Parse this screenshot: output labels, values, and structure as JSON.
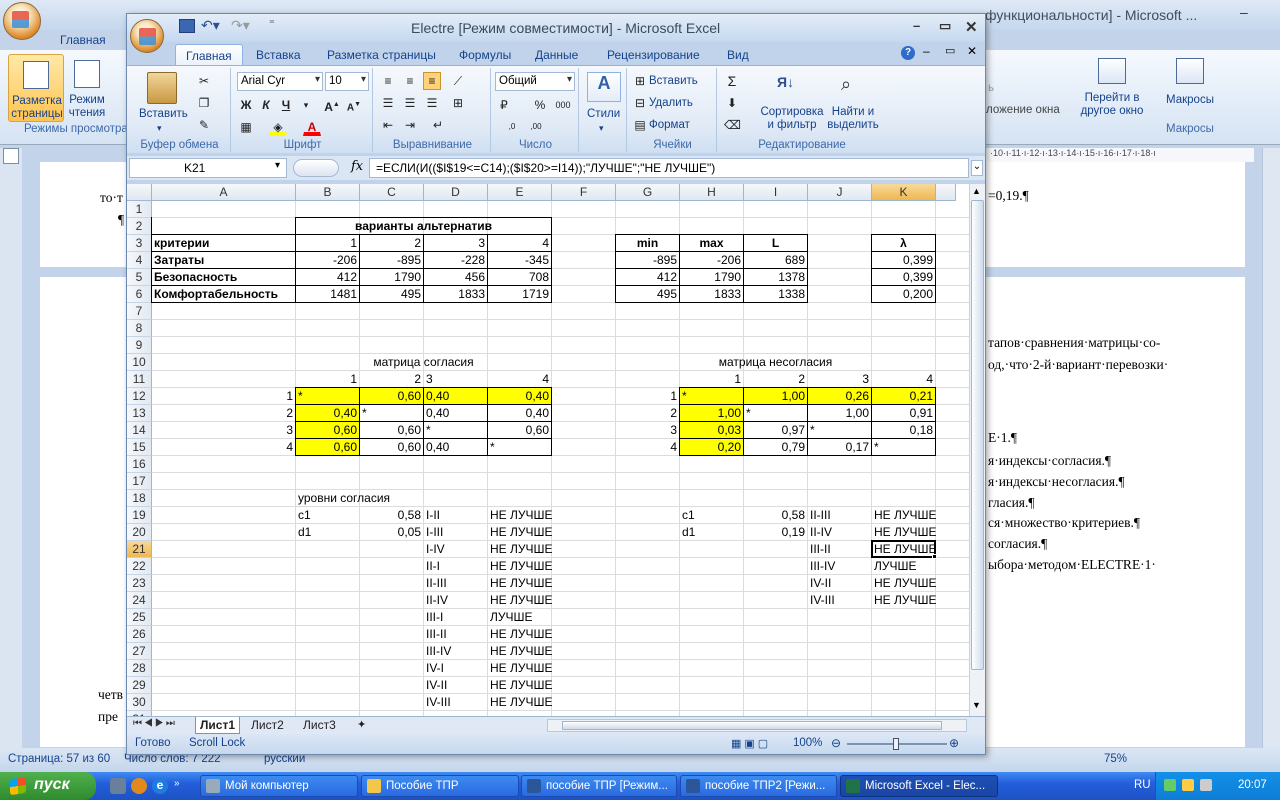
{
  "word": {
    "title_tail": "функциональности] - Microsoft ...",
    "tab_home": "Главная",
    "views": {
      "print_layout": "Разметка страницы",
      "reading": "Режим чтения",
      "group": "Режимы просмотра"
    },
    "right": {
      "window_fragment": "ложение окна",
      "goto_other": "Перейти в другое окно",
      "macros": "Макросы",
      "macros_group": "Макросы"
    },
    "doc_left": {
      "line1": "то·т",
      "line2": "¶",
      "line3": "четв",
      "line4": "пре"
    },
    "doc_right": {
      "l1": "=0,19.¶",
      "l2": "тапов·сравнения·матрицы·со-",
      "l3": "од,·что·2-й·вариант·перевозки·",
      "l4": "Е·1.¶",
      "l5": "я·индексы·согласия.¶",
      "l6": "я·индексы·несогласия.¶",
      "l7": "гласия.¶",
      "l8": "ся·множество·критериев.¶",
      "l9": "согласия.¶",
      "l10": "ыбора·методом·ELECTRE·1·"
    },
    "status": {
      "page": "Страница: 57 из 60",
      "words": "Число слов: 7 222",
      "lang": "русский",
      "zoom": "75%"
    }
  },
  "excel": {
    "title": "Electre  [Режим совместимости] - Microsoft Excel",
    "tabs": [
      "Главная",
      "Вставка",
      "Разметка страницы",
      "Формулы",
      "Данные",
      "Рецензирование",
      "Вид"
    ],
    "ribbon": {
      "paste": "Вставить",
      "clipboard": "Буфер обмена",
      "font_name": "Arial Cyr",
      "font_size": "10",
      "font_group": "Шрифт",
      "bold": "Ж",
      "italic": "К",
      "underline": "Ч",
      "align_group": "Выравнивание",
      "number_format": "Общий",
      "number_group": "Число",
      "styles": "Стили",
      "insert": "Вставить",
      "delete": "Удалить",
      "format": "Формат",
      "cells_group": "Ячейки",
      "sort": "Сортировка и фильтр",
      "find": "Найти и выделить",
      "editing_group": "Редактирование"
    },
    "name_box": "K21",
    "formula": "=ЕСЛИ(И(($I$19<=C14);($I$20>=I14));\"ЛУЧШЕ\";\"НЕ ЛУЧШЕ\")",
    "columns": [
      "A",
      "B",
      "C",
      "D",
      "E",
      "F",
      "G",
      "H",
      "I",
      "J",
      "K"
    ],
    "rows": [
      "1",
      "2",
      "3",
      "4",
      "5",
      "6",
      "7",
      "8",
      "9",
      "10",
      "11",
      "12",
      "13",
      "14",
      "15",
      "16",
      "17",
      "18",
      "19",
      "20",
      "21",
      "22",
      "23",
      "24",
      "25",
      "26",
      "27",
      "28",
      "29",
      "30",
      "31"
    ],
    "cells": {
      "B2": "варианты альтернатив",
      "A3": "критерии",
      "B3": "1",
      "C3": "2",
      "D3": "3",
      "E3": "4",
      "G3": "min",
      "H3": "max",
      "I3": "L",
      "K3": "λ",
      "A4": "Затраты",
      "B4": "-206",
      "C4": "-895",
      "D4": "-228",
      "E4": "-345",
      "G4": "-895",
      "H4": "-206",
      "I4": "689",
      "K4": "0,399",
      "A5": "Безопасность",
      "B5": "412",
      "C5": "1790",
      "D5": "456",
      "E5": "708",
      "G5": "412",
      "H5": "1790",
      "I5": "1378",
      "K5": "0,399",
      "A6": "Комфортабельность",
      "B6": "1481",
      "C6": "495",
      "D6": "1833",
      "E6": "1719",
      "G6": "495",
      "H6": "1833",
      "I6": "1338",
      "K6": "0,200",
      "C10": "матрица согласия",
      "I10": "матрица несогласия",
      "B11": "1",
      "C11": "2",
      "D11": "3",
      "E11": "4",
      "H11": "1",
      "I11": "2",
      "J11": "3",
      "K11": "4",
      "A12": "1",
      "B12": "*",
      "C12": "0,60",
      "D12": "0,40",
      "E12": "0,40",
      "G12": "1",
      "H12": "*",
      "I12": "1,00",
      "J12": "0,26",
      "K12": "0,21",
      "A13": "2",
      "B13": "0,40",
      "C13": "*",
      "D13": "0,40",
      "E13": "0,40",
      "G13": "2",
      "H13": "1,00",
      "I13": "*",
      "J13": "1,00",
      "K13": "0,91",
      "A14": "3",
      "B14": "0,60",
      "C14": "0,60",
      "D14": "*",
      "E14": "0,60",
      "G14": "3",
      "H14": "0,03",
      "I14": "0,97",
      "J14": "*",
      "K14": "0,18",
      "A15": "4",
      "B15": "0,60",
      "C15": "0,60",
      "D15": "0,40",
      "E15": "*",
      "G15": "4",
      "H15": "0,20",
      "I15": "0,79",
      "J15": "0,17",
      "K15": "*",
      "B18": "уровни согласия",
      "B19": "c1",
      "C19": "0,58",
      "D19": "I-II",
      "E19": "НЕ ЛУЧШЕ",
      "H19": "c1",
      "I19": "0,58",
      "J19": "II-III",
      "K19": "НЕ ЛУЧШЕ",
      "B20": "d1",
      "C20": "0,05",
      "D20": "I-III",
      "E20": "НЕ ЛУЧШЕ",
      "H20": "d1",
      "I20": "0,19",
      "J20": "II-IV",
      "K20": "НЕ ЛУЧШЕ",
      "D21": "I-IV",
      "E21": "НЕ ЛУЧШЕ",
      "J21": "III-II",
      "K21": "НЕ ЛУЧШЕ",
      "D22": "II-I",
      "E22": "НЕ ЛУЧШЕ",
      "J22": "III-IV",
      "K22": "ЛУЧШЕ",
      "D23": "II-III",
      "E23": "НЕ ЛУЧШЕ",
      "J23": "IV-II",
      "K23": "НЕ ЛУЧШЕ",
      "D24": "II-IV",
      "E24": "НЕ ЛУЧШЕ",
      "J24": "IV-III",
      "K24": "НЕ ЛУЧШЕ",
      "D25": "III-I",
      "E25": "ЛУЧШЕ",
      "D26": "III-II",
      "E26": "НЕ ЛУЧШЕ",
      "D27": "III-IV",
      "E27": "НЕ ЛУЧШЕ",
      "D28": "IV-I",
      "E28": "НЕ ЛУЧШЕ",
      "D29": "IV-II",
      "E29": "НЕ ЛУЧШЕ",
      "D30": "IV-III",
      "E30": "НЕ ЛУЧШЕ"
    },
    "sheets": [
      "Лист1",
      "Лист2",
      "Лист3"
    ],
    "status": {
      "ready": "Готово",
      "scroll": "Scroll Lock",
      "zoom": "100%"
    }
  },
  "taskbar": {
    "start": "пуск",
    "items": [
      "Мой компьютер",
      "Пособие ТПР",
      "пособие ТПР [Режим...",
      "пособие ТПР2 [Режи...",
      "Microsoft Excel - Elec..."
    ],
    "lang": "RU",
    "clock": "20:07"
  }
}
